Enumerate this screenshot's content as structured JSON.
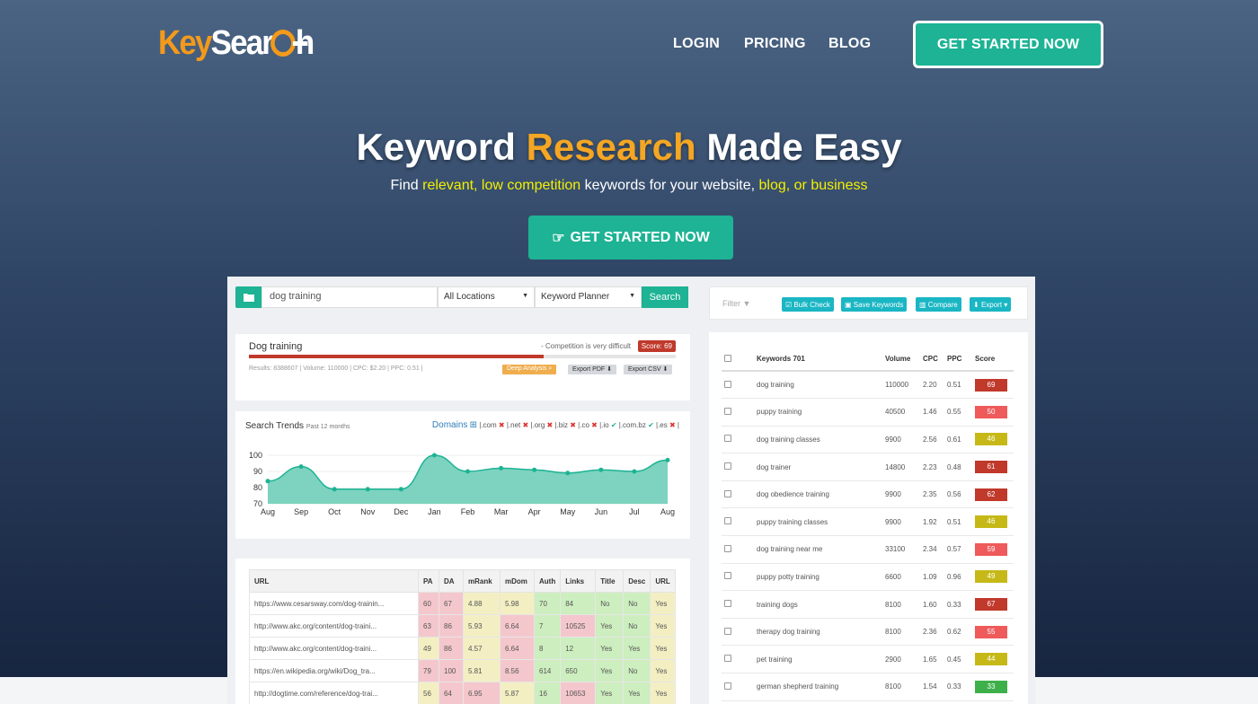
{
  "header": {
    "logo_left": "Key",
    "logo_right": "Sear",
    "logo_tail": "h",
    "nav": [
      "LOGIN",
      "PRICING",
      "BLOG"
    ],
    "cta": "GET STARTED NOW"
  },
  "hero": {
    "title_a": "Keyword ",
    "title_hl": "Research",
    "title_b": " Made Easy",
    "sub_a": "Find ",
    "sub_hl1": "relevant, low competition",
    "sub_b": " keywords for your website, ",
    "sub_hl2": "blog, or business",
    "cta": "GET STARTED NOW"
  },
  "search": {
    "value": "dog training",
    "location": "All Locations",
    "source": "Keyword Planner",
    "button": "Search"
  },
  "summary": {
    "keyword": "Dog training",
    "competition": "- Competition is very difficult",
    "score": "Score: 69",
    "score_fraction": 0.69,
    "meta": "Results: 8388607 | Volume: 110000 | CPC: $2.20 | PPC: 0.51 |",
    "deep": "Deep Analysis",
    "pdf": "Export PDF",
    "csv": "Export CSV"
  },
  "trends": {
    "title": "Search Trends",
    "period": "Past 12 months",
    "domains_label": "Domains",
    "domains": [
      {
        "t": "|.com",
        "ok": false
      },
      {
        "t": "|.net",
        "ok": false
      },
      {
        "t": "|.org",
        "ok": false
      },
      {
        "t": "|.biz",
        "ok": false
      },
      {
        "t": "|.co",
        "ok": false
      },
      {
        "t": "|.io",
        "ok": true
      },
      {
        "t": "|.com.bz",
        "ok": true
      },
      {
        "t": "|.es",
        "ok": false
      }
    ],
    "end": "|"
  },
  "chart_data": {
    "type": "area",
    "categories": [
      "Aug",
      "Sep",
      "Oct",
      "Nov",
      "Dec",
      "Jan",
      "Feb",
      "Mar",
      "Apr",
      "May",
      "Jun",
      "Jul",
      "Aug"
    ],
    "values": [
      84,
      93,
      79,
      79,
      79,
      100,
      90,
      92,
      91,
      89,
      91,
      90,
      97
    ],
    "yticks": [
      100,
      90,
      80,
      70
    ],
    "ylim": [
      70,
      100
    ],
    "color": "#7dd3bf"
  },
  "url_table": {
    "headers": [
      "URL",
      "PA",
      "DA",
      "mRank",
      "mDom",
      "Auth",
      "Links",
      "Title",
      "Desc",
      "URL"
    ],
    "rows": [
      [
        "https://www.cesarsway.com/dog-trainin...",
        "60",
        "67",
        "4.88",
        "5.98",
        "70",
        "84",
        "No",
        "No",
        "Yes"
      ],
      [
        "http://www.akc.org/content/dog-traini...",
        "63",
        "86",
        "5.93",
        "6.64",
        "7",
        "10525",
        "Yes",
        "No",
        "Yes"
      ],
      [
        "http://www.akc.org/content/dog-traini...",
        "49",
        "86",
        "4.57",
        "6.64",
        "8",
        "12",
        "Yes",
        "Yes",
        "Yes"
      ],
      [
        "https://en.wikipedia.org/wiki/Dog_tra...",
        "79",
        "100",
        "5.81",
        "8.56",
        "614",
        "650",
        "Yes",
        "No",
        "Yes"
      ],
      [
        "http://dogtime.com/reference/dog-trai...",
        "56",
        "64",
        "6.95",
        "5.87",
        "16",
        "10653",
        "Yes",
        "Yes",
        "Yes"
      ]
    ]
  },
  "toolbar": {
    "filter": "Filter",
    "bulk": "Bulk Check",
    "save": "Save Keywords",
    "compare": "Compare",
    "export": "Export"
  },
  "kw_table": {
    "headers": [
      "Keywords 701",
      "Volume",
      "CPC",
      "PPC",
      "Score"
    ],
    "rows": [
      [
        "dog training",
        "110000",
        "2.20",
        "0.51",
        "69",
        "#c0392b"
      ],
      [
        "puppy training",
        "40500",
        "1.46",
        "0.55",
        "50",
        "#ef5a5a"
      ],
      [
        "dog training classes",
        "9900",
        "2.56",
        "0.61",
        "46",
        "#c6b917"
      ],
      [
        "dog trainer",
        "14800",
        "2.23",
        "0.48",
        "61",
        "#c0392b"
      ],
      [
        "dog obedience training",
        "9900",
        "2.35",
        "0.56",
        "62",
        "#c0392b"
      ],
      [
        "puppy training classes",
        "9900",
        "1.92",
        "0.51",
        "46",
        "#c6b917"
      ],
      [
        "dog training near me",
        "33100",
        "2.34",
        "0.57",
        "59",
        "#ef5a5a"
      ],
      [
        "puppy potty training",
        "6600",
        "1.09",
        "0.96",
        "49",
        "#c6b917"
      ],
      [
        "training dogs",
        "8100",
        "1.60",
        "0.33",
        "67",
        "#c0392b"
      ],
      [
        "therapy dog training",
        "8100",
        "2.36",
        "0.62",
        "55",
        "#ef5a5a"
      ],
      [
        "pet training",
        "2900",
        "1.65",
        "0.45",
        "44",
        "#c6b917"
      ],
      [
        "german shepherd training",
        "8100",
        "1.54",
        "0.33",
        "33",
        "#3eb049"
      ]
    ]
  }
}
